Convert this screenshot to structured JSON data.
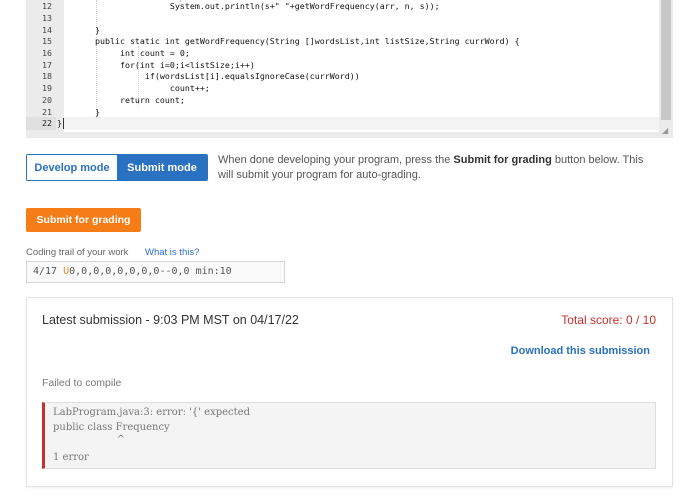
{
  "editor": {
    "lines": [
      {
        "num": "12",
        "code": "                    System.out.println(s+\" \"+getWordFrequency(arr, n, s));"
      },
      {
        "num": "13",
        "code": ""
      },
      {
        "num": "14",
        "code": "     }"
      },
      {
        "num": "15",
        "code": "     public static int getWordFrequency(String []wordsList,int listSize,String currWord) {"
      },
      {
        "num": "16",
        "code": "          int count = 0;"
      },
      {
        "num": "17",
        "code": "          for(int i=0;i<listSize;i++)"
      },
      {
        "num": "18",
        "code": "               if(wordsList[i].equalsIgnoreCase(currWord))"
      },
      {
        "num": "19",
        "code": "                    count++;"
      },
      {
        "num": "20",
        "code": "          return count;"
      },
      {
        "num": "21",
        "code": "     }"
      },
      {
        "num": "22",
        "code": "}"
      }
    ]
  },
  "mode": {
    "develop_label": "Develop mode",
    "submit_label": "Submit mode",
    "help_prefix": "When done developing your program, press the ",
    "help_bold": "Submit for grading",
    "help_suffix": " button below. This will submit your program for auto-grading."
  },
  "submit_button": "Submit for grading",
  "trail": {
    "label": "Coding trail of your work",
    "link": "What is this?",
    "prefix": "4/17 ",
    "highlight": "U",
    "rest": "0,0,0,0,0,0,0,0--0,0 min:10"
  },
  "submission": {
    "title": "Latest submission - 9:03 PM MST on 04/17/22",
    "score": "Total score: 0 / 10",
    "download": "Download this submission",
    "status": "Failed to compile",
    "error_lines": [
      "LabProgram.java:3: error: '{' expected",
      "public class Frequency",
      "                    ^",
      "",
      "1 error"
    ]
  },
  "colors": {
    "accent": "#2a71c1",
    "submit": "#f57c17",
    "error": "#c9302c"
  }
}
